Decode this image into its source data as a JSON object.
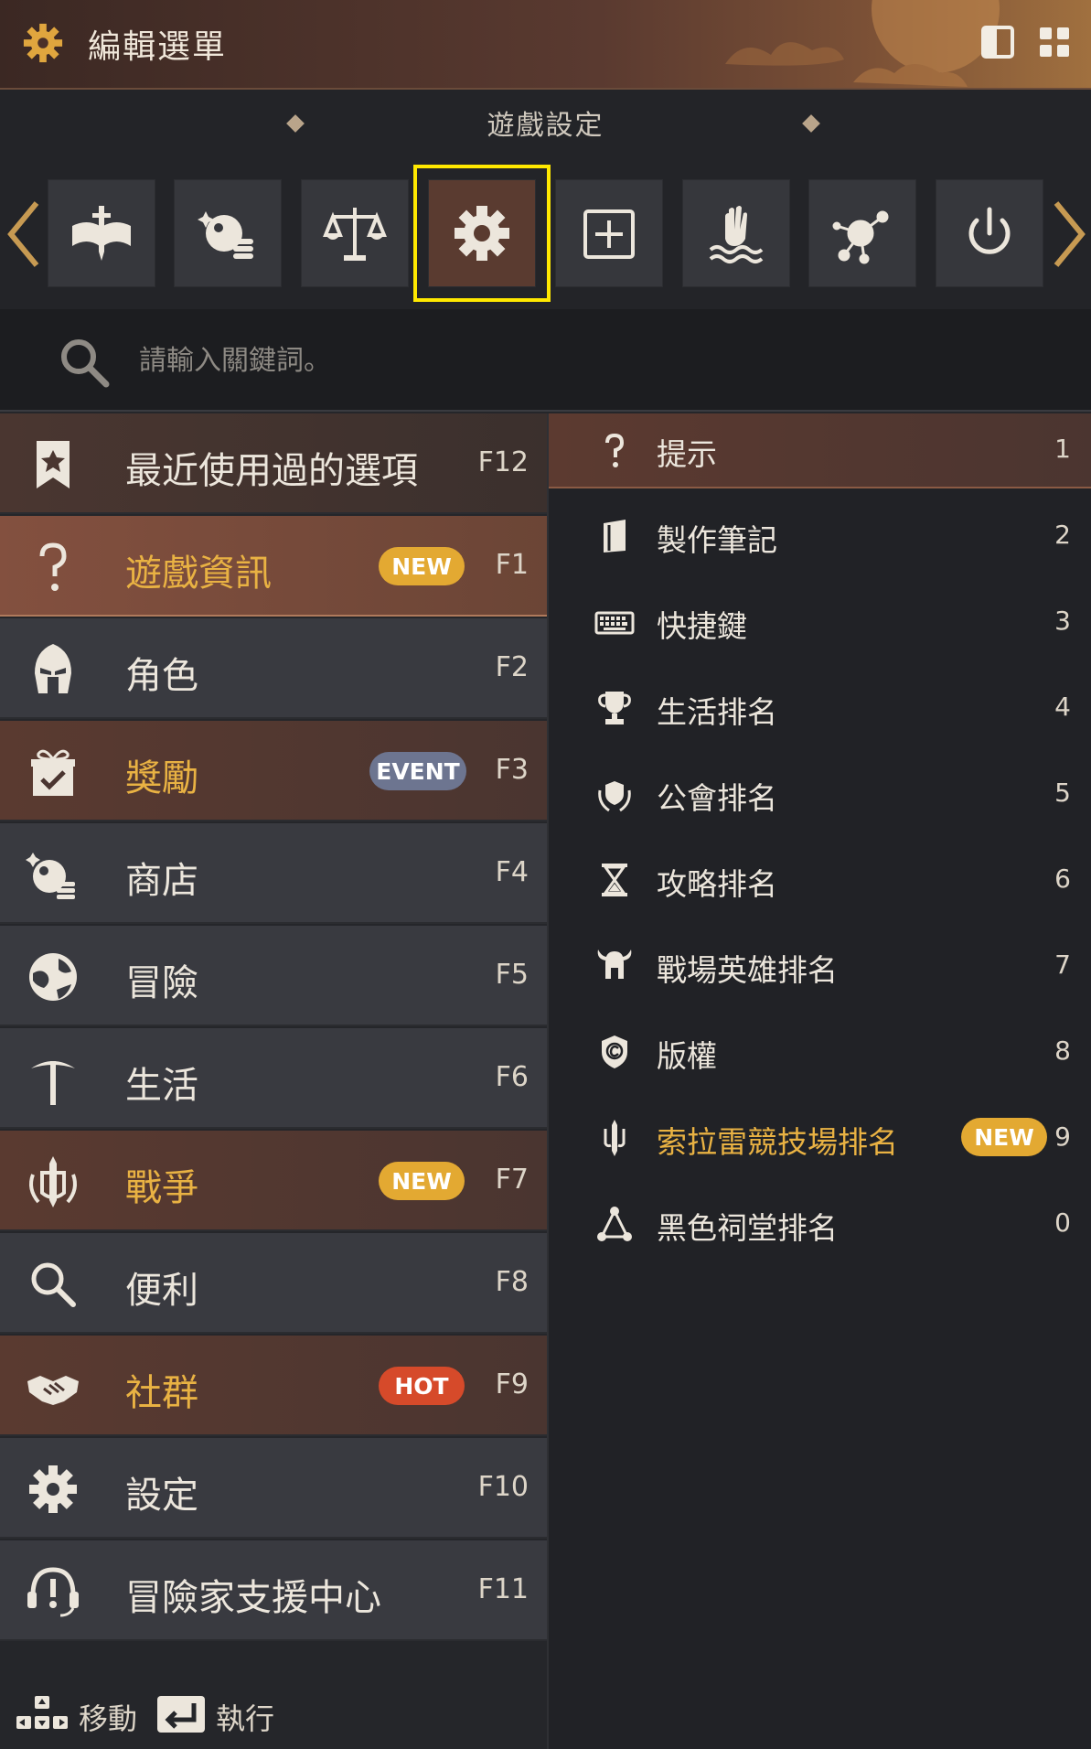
{
  "header": {
    "title": "編輯選單"
  },
  "category_bar": {
    "title": "遊戲設定",
    "buttons": [
      {
        "icon": "book-sword-icon"
      },
      {
        "icon": "pearl-shop-icon"
      },
      {
        "icon": "scale-icon"
      },
      {
        "icon": "gear-icon",
        "active": true
      },
      {
        "icon": "plus-box-icon"
      },
      {
        "icon": "hand-water-icon"
      },
      {
        "icon": "node-icon"
      },
      {
        "icon": "power-icon"
      }
    ]
  },
  "search": {
    "placeholder": "請輸入關鍵詞。"
  },
  "menu": [
    {
      "label": "最近使用過的選項",
      "key": "F12",
      "icon": "bookmark-star-icon",
      "style": "first"
    },
    {
      "label": "遊戲資訊",
      "key": "F1",
      "icon": "question-icon",
      "badge": "NEW",
      "style": "selected"
    },
    {
      "label": "角色",
      "key": "F2",
      "icon": "helmet-icon"
    },
    {
      "label": "獎勵",
      "key": "F3",
      "icon": "gift-icon",
      "badge": "EVENT",
      "style": "hl"
    },
    {
      "label": "商店",
      "key": "F4",
      "icon": "pearl-shop-icon"
    },
    {
      "label": "冒險",
      "key": "F5",
      "icon": "globe-icon"
    },
    {
      "label": "生活",
      "key": "F6",
      "icon": "pickaxe-icon"
    },
    {
      "label": "戰爭",
      "key": "F7",
      "icon": "war-crest-icon",
      "badge": "NEW",
      "style": "hl"
    },
    {
      "label": "便利",
      "key": "F8",
      "icon": "search-icon"
    },
    {
      "label": "社群",
      "key": "F9",
      "icon": "handshake-icon",
      "badge": "HOT",
      "style": "hl"
    },
    {
      "label": "設定",
      "key": "F10",
      "icon": "gear-icon"
    },
    {
      "label": "冒險家支援中心",
      "key": "F11",
      "icon": "headset-icon"
    }
  ],
  "submenu": [
    {
      "label": "提示",
      "key": "1",
      "icon": "question-icon",
      "selected": true
    },
    {
      "label": "製作筆記",
      "key": "2",
      "icon": "notebook-icon"
    },
    {
      "label": "快捷鍵",
      "key": "3",
      "icon": "keyboard-icon"
    },
    {
      "label": "生活排名",
      "key": "4",
      "icon": "trophy-icon"
    },
    {
      "label": "公會排名",
      "key": "5",
      "icon": "guild-shield-icon"
    },
    {
      "label": "攻略排名",
      "key": "6",
      "icon": "hourglass-icon"
    },
    {
      "label": "戰場英雄排名",
      "key": "7",
      "icon": "viking-helmet-icon"
    },
    {
      "label": "版權",
      "key": "8",
      "icon": "copyright-shield-icon"
    },
    {
      "label": "索拉雷競技場排名",
      "key": "9",
      "icon": "sword-crest-icon",
      "badge": "NEW",
      "gold": true
    },
    {
      "label": "黑色祠堂排名",
      "key": "0",
      "icon": "triangle-nodes-icon"
    }
  ],
  "footer": {
    "move_label": "移動",
    "execute_label": "執行"
  },
  "colors": {
    "accent_gold": "#e9b243",
    "highlight_outline": "#ffe800",
    "badge_new": "#e3a932",
    "badge_event": "#6d7590",
    "badge_hot": "#d64a2a"
  }
}
